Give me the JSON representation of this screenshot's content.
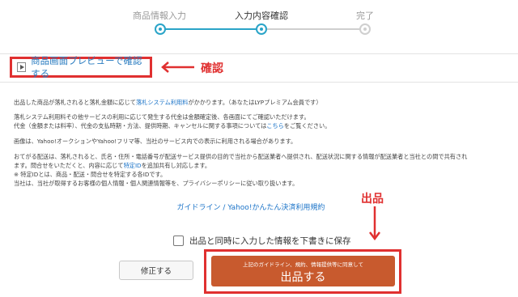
{
  "steps": [
    {
      "label": "商品情報入力",
      "state": "done"
    },
    {
      "label": "入力内容確認",
      "state": "active"
    },
    {
      "label": "完了",
      "state": "pending"
    }
  ],
  "preview": {
    "label": "商品画面プレビューで確認する"
  },
  "annotations": {
    "confirm": "確認",
    "listing": "出品"
  },
  "notices": {
    "fee_pre": "出品した商品が落札されると落札金額に応じて",
    "fee_link": "落札システム利用料",
    "fee_post": "がかかります。（あなたはLYPプレミアム会員です）",
    "other_line1": "落札システム利用料その他サービスの利用に応じて発生する代金は金額確定後、各画面にてご確認いただけます。",
    "other_line2_pre": "代金（金額または料率）、代金の支払時期・方法、提供時期、キャンセルに関する事項については",
    "other_line2_link": "こちら",
    "other_line2_post": "をご覧ください。",
    "image_notice": "画像は、Yahoo!オークションやYahoo!フリマ等、当社のサービス内での表示に利用される場合があります。",
    "shipping_line1": "おてがる配送は、落札されると、氏名・住所・電話番号が配送サービス提供の目的で当社から配送業者へ提供され、配送状況に関する情報が配送業者と当社との間で共有され",
    "shipping_line2_pre": "ます。問合せをいただくと、内容に応じて",
    "shipping_line2_link": "特定ID",
    "shipping_line2_post": "を追加共有し対応します。",
    "shipping_line3": "※ 特定IDとは、商品・配送・問合せを特定する各IDです。",
    "shipping_line4": "当社は、当社が取得するお客様の個人情報・個人関連情報等を、プライバシーポリシーに従い取り扱います。"
  },
  "links": {
    "guideline": "ガイドライン",
    "separator": " / ",
    "payment_terms": "Yahoo!かんたん決済利用規約"
  },
  "draft_checkbox": {
    "label": "出品と同時に入力した情報を下書きに保存",
    "checked": false
  },
  "buttons": {
    "modify": "修正する",
    "submit_note": "上記のガイドライン、規約、情報提供等に同意して",
    "submit": "出品する"
  },
  "colors": {
    "accent": "#2aa4c8",
    "annotation": "#e03030",
    "submit": "#c85a2e",
    "link": "#1a73c8"
  }
}
